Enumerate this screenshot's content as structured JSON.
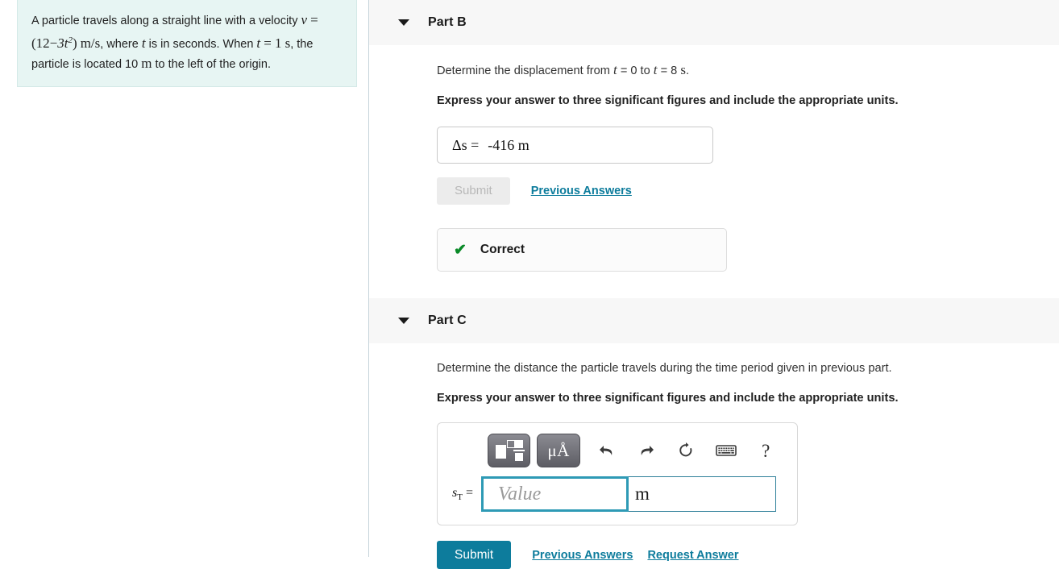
{
  "problem": {
    "text_1": "A particle travels along a straight line with a velocity",
    "v_symbol": "v",
    "eq": "=",
    "expr_open": "(12",
    "minus": "−",
    "coef": "3t",
    "exp": "2",
    "expr_close": ")",
    "units": "m/s",
    "text_2": ", where",
    "t_symbol": "t",
    "text_3": "is in seconds. When",
    "t_symbol_2": "t",
    "eq2": "= 1",
    "s_unit": "s",
    "text_4": ", the particle is located 10",
    "m_unit": "m",
    "text_5": "to the left of the",
    "text_6": "origin."
  },
  "part_b": {
    "caret_icon": "chevron-down-icon",
    "title": "Part B",
    "question_prefix": "Determine the displacement from",
    "t1": "t",
    "t1_eq": "= 0 to",
    "t2": "t",
    "t2_eq": "= 8",
    "time_unit": "s",
    "period": ".",
    "instruction": "Express your answer to three significant figures and include the appropriate units.",
    "answer_label": "Δs =",
    "answer_value": "-416 m",
    "submit_label": "Submit",
    "previous_answers_label": "Previous Answers",
    "feedback": {
      "icon": "check-icon",
      "label": "Correct",
      "color": "#0a8a28"
    }
  },
  "part_c": {
    "caret_icon": "chevron-down-icon",
    "title": "Part C",
    "question": "Determine the distance the particle travels during the time period given in previous part.",
    "instruction": "Express your answer to three significant figures and include the appropriate units.",
    "toolbar": {
      "template_button": "math-template-icon",
      "units_button": "μÅ",
      "undo_icon": "undo-icon",
      "redo_icon": "redo-icon",
      "reset_icon": "reset-icon",
      "keyboard_icon": "keyboard-icon",
      "help_icon": "?"
    },
    "input_label_base": "s",
    "input_label_sub": "T",
    "input_label_eq": "=",
    "value_placeholder": "Value",
    "units_value": "m",
    "submit_label": "Submit",
    "previous_answers_label": "Previous Answers",
    "request_answer_label": "Request Answer"
  },
  "theme": {
    "accent": "#0d7c9c",
    "focus_border": "#2e9ab5",
    "problem_bg": "#e7f5f3",
    "header_bg": "#f7f7f7",
    "correct_green": "#0a8a28"
  }
}
